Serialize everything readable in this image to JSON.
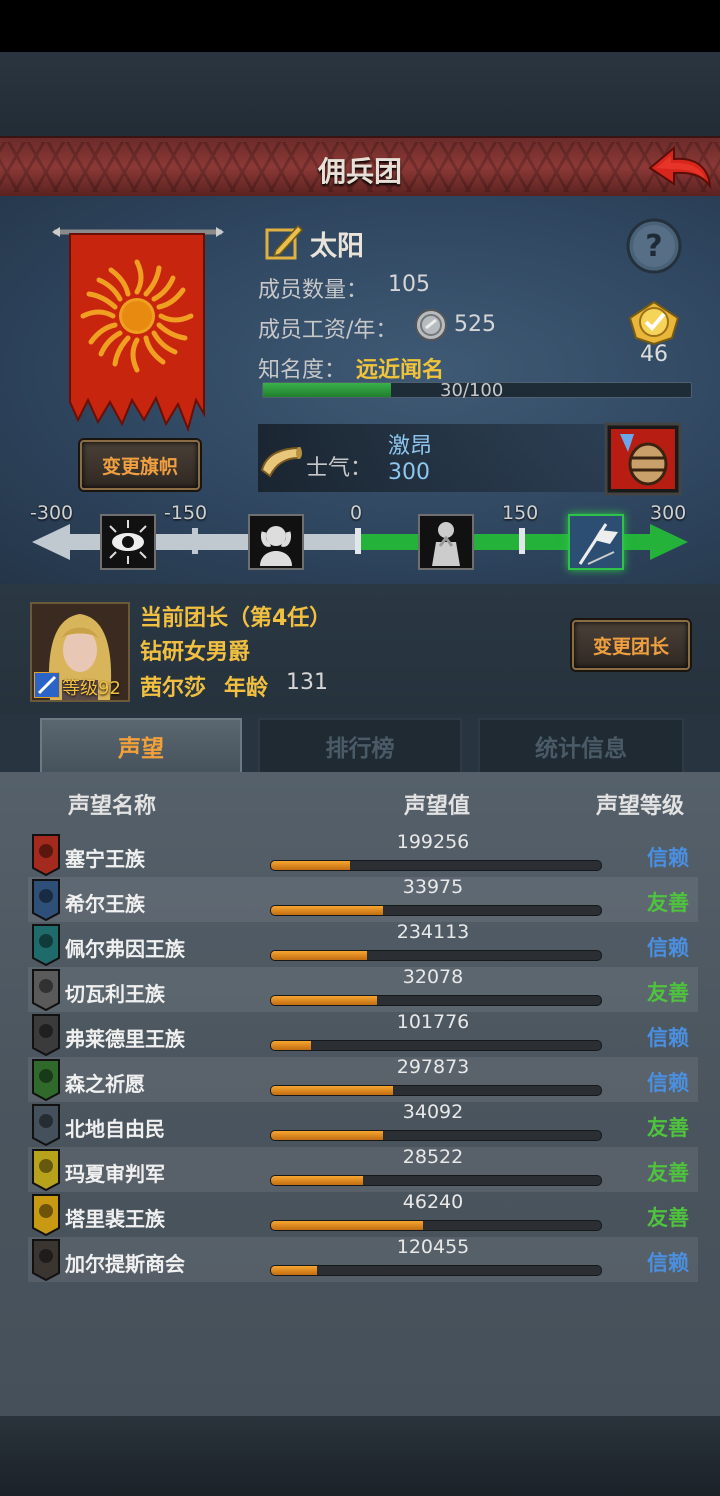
{
  "header": {
    "title": "佣兵团"
  },
  "guild": {
    "name": "太阳",
    "members_label": "成员数量：",
    "members_value": "105",
    "wage_label": "成员工资/年：",
    "wage_value": "525",
    "fame_label": "知名度：",
    "fame_value": "远近闻名",
    "fame_progress": "30/100",
    "fame_ratio": 0.3,
    "rank_value": "46",
    "change_banner_label": "变更旗帜",
    "morale_label": "士气：",
    "morale_status": "激昂",
    "morale_value": "300"
  },
  "morale_scale": {
    "ticks": [
      "-300",
      "-150",
      "0",
      "150",
      "300"
    ],
    "icons": [
      "eye-icon",
      "despair-icon",
      "prayer-icon",
      "victory-flag-icon"
    ]
  },
  "leader": {
    "title": "当前团长（第4任）",
    "rank_title": "钻研女男爵",
    "name": "茜尔莎",
    "age_label": "年龄",
    "age_value": "131",
    "level_text": "等级92",
    "change_leader_label": "变更团长"
  },
  "tabs": [
    {
      "label": "声望",
      "active": true
    },
    {
      "label": "排行榜",
      "active": false
    },
    {
      "label": "统计信息",
      "active": false
    }
  ],
  "table": {
    "headers": [
      "声望名称",
      "声望值",
      "声望等级"
    ],
    "rows": [
      {
        "name": "塞宁王族",
        "value": "199256",
        "level": "信赖",
        "level_color": "#4a8fe0",
        "ratio": 0.24,
        "emblem_color": "#a52a1e"
      },
      {
        "name": "希尔王族",
        "value": "33975",
        "level": "友善",
        "level_color": "#4fc23e",
        "ratio": 0.34,
        "emblem_color": "#2e4f78"
      },
      {
        "name": "佩尔弗因王族",
        "value": "234113",
        "level": "信赖",
        "level_color": "#4a8fe0",
        "ratio": 0.29,
        "emblem_color": "#1f6b6b"
      },
      {
        "name": "切瓦利王族",
        "value": "32078",
        "level": "友善",
        "level_color": "#4fc23e",
        "ratio": 0.32,
        "emblem_color": "#5a5a5a"
      },
      {
        "name": "弗莱德里王族",
        "value": "101776",
        "level": "信赖",
        "level_color": "#4a8fe0",
        "ratio": 0.12,
        "emblem_color": "#3b3b3b"
      },
      {
        "name": "森之祈愿",
        "value": "297873",
        "level": "信赖",
        "level_color": "#4a8fe0",
        "ratio": 0.37,
        "emblem_color": "#2f6a2c"
      },
      {
        "name": "北地自由民",
        "value": "34092",
        "level": "友善",
        "level_color": "#4fc23e",
        "ratio": 0.34,
        "emblem_color": "#44505c"
      },
      {
        "name": "玛夏审判军",
        "value": "28522",
        "level": "友善",
        "level_color": "#4fc23e",
        "ratio": 0.28,
        "emblem_color": "#b8a21c"
      },
      {
        "name": "塔里裴王族",
        "value": "46240",
        "level": "友善",
        "level_color": "#4fc23e",
        "ratio": 0.46,
        "emblem_color": "#c89a14"
      },
      {
        "name": "加尔提斯商会",
        "value": "120455",
        "level": "信赖",
        "level_color": "#4a8fe0",
        "ratio": 0.14,
        "emblem_color": "#3a3530"
      }
    ]
  },
  "colors": {
    "accent_orange": "#f0a040",
    "trust_blue": "#4a8fe0",
    "friendly_green": "#4fc23e"
  }
}
